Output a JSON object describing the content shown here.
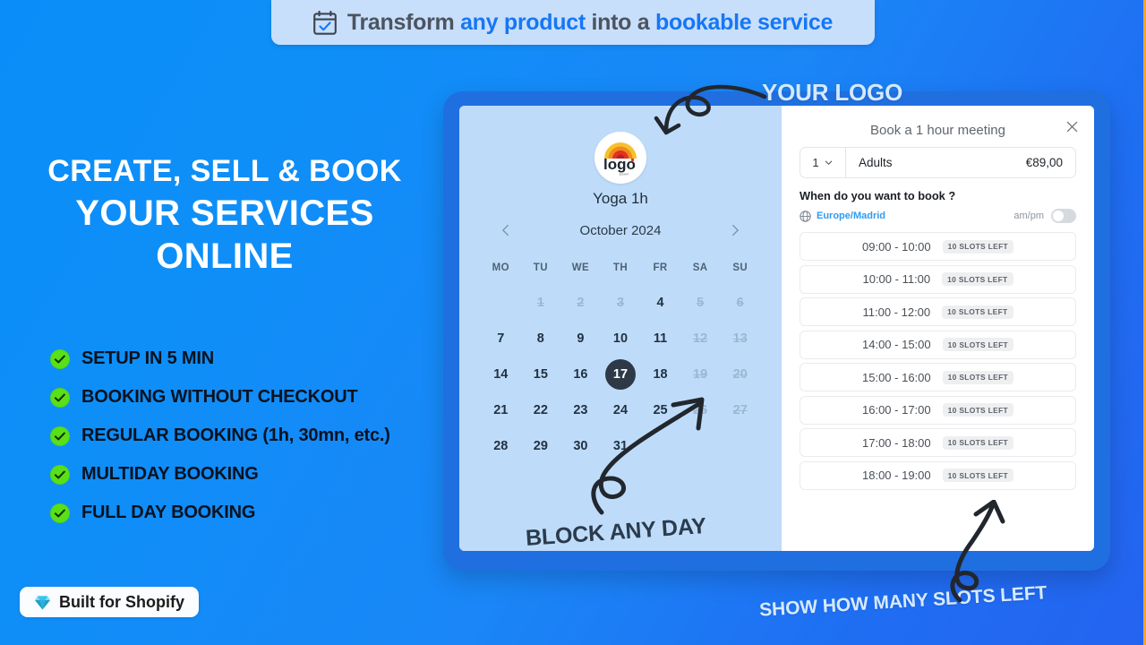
{
  "banner": {
    "icon": "calendar-check-icon",
    "segments": [
      {
        "text": "Transform ",
        "accent": false
      },
      {
        "text": "any product",
        "accent": true
      },
      {
        "text": " into a ",
        "accent": false
      },
      {
        "text": "bookable service",
        "accent": true
      }
    ],
    "full_text": "Transform any product into a bookable service"
  },
  "headline": {
    "line1": "CREATE, SELL & BOOK",
    "line2": "YOUR SERVICES",
    "line3": "ONLINE"
  },
  "features": [
    {
      "label": "SETUP IN 5 MIN",
      "icon": "check-circle-icon"
    },
    {
      "label": "BOOKING WITHOUT CHECKOUT",
      "icon": "check-circle-icon"
    },
    {
      "label": "REGULAR BOOKING (1h, 30mn, etc.)",
      "icon": "check-circle-icon"
    },
    {
      "label": "MULTIDAY BOOKING",
      "icon": "check-circle-icon"
    },
    {
      "label": "FULL DAY BOOKING",
      "icon": "check-circle-icon"
    }
  ],
  "badge": {
    "label": "Built for Shopify",
    "icon": "diamond-icon"
  },
  "calendar": {
    "logo_alt": "logo",
    "service_title": "Yoga 1h",
    "month_label": "October 2024",
    "prev_icon": "chevron-left-icon",
    "next_icon": "chevron-right-icon",
    "weekdays": [
      "MO",
      "TU",
      "WE",
      "TH",
      "FR",
      "SA",
      "SU"
    ],
    "leading_blanks": 1,
    "days": [
      {
        "n": "1",
        "state": "disabled"
      },
      {
        "n": "2",
        "state": "disabled"
      },
      {
        "n": "3",
        "state": "disabled"
      },
      {
        "n": "4",
        "state": "available"
      },
      {
        "n": "5",
        "state": "disabled"
      },
      {
        "n": "6",
        "state": "disabled"
      },
      {
        "n": "7",
        "state": "available"
      },
      {
        "n": "8",
        "state": "available"
      },
      {
        "n": "9",
        "state": "available"
      },
      {
        "n": "10",
        "state": "available"
      },
      {
        "n": "11",
        "state": "available"
      },
      {
        "n": "12",
        "state": "disabled"
      },
      {
        "n": "13",
        "state": "disabled"
      },
      {
        "n": "14",
        "state": "available"
      },
      {
        "n": "15",
        "state": "available"
      },
      {
        "n": "16",
        "state": "available"
      },
      {
        "n": "17",
        "state": "selected"
      },
      {
        "n": "18",
        "state": "available"
      },
      {
        "n": "19",
        "state": "disabled"
      },
      {
        "n": "20",
        "state": "disabled"
      },
      {
        "n": "21",
        "state": "available"
      },
      {
        "n": "22",
        "state": "available"
      },
      {
        "n": "23",
        "state": "available"
      },
      {
        "n": "24",
        "state": "available"
      },
      {
        "n": "25",
        "state": "available"
      },
      {
        "n": "26",
        "state": "disabled"
      },
      {
        "n": "27",
        "state": "disabled"
      },
      {
        "n": "28",
        "state": "available"
      },
      {
        "n": "29",
        "state": "available"
      },
      {
        "n": "30",
        "state": "available"
      },
      {
        "n": "31",
        "state": "available"
      }
    ]
  },
  "booking": {
    "title": "Book a 1 hour meeting",
    "close_icon": "close-icon",
    "quantity": "1",
    "quantity_chevron": "chevron-down-icon",
    "variant_label": "Adults",
    "price": "€89,00",
    "when_question": "When do you want to book ?",
    "timezone_icon": "globe-icon",
    "timezone": "Europe/Madrid",
    "ampm_label": "am/pm",
    "ampm_on": false,
    "slots": [
      {
        "time": "09:00 - 10:00",
        "badge": "10 SLOTS LEFT"
      },
      {
        "time": "10:00 - 11:00",
        "badge": "10 SLOTS LEFT"
      },
      {
        "time": "11:00 - 12:00",
        "badge": "10 SLOTS LEFT"
      },
      {
        "time": "14:00 - 15:00",
        "badge": "10 SLOTS LEFT"
      },
      {
        "time": "15:00 - 16:00",
        "badge": "10 SLOTS LEFT"
      },
      {
        "time": "16:00 - 17:00",
        "badge": "10 SLOTS LEFT"
      },
      {
        "time": "17:00 - 18:00",
        "badge": "10 SLOTS LEFT"
      },
      {
        "time": "18:00 - 19:00",
        "badge": "10 SLOTS LEFT"
      }
    ]
  },
  "annotations": {
    "your_logo": "YOUR LOGO",
    "block_any_day": "BLOCK ANY DAY",
    "show_slots": "SHOW HOW MANY SLOTS LEFT"
  },
  "colors": {
    "background_start": "#0a8df8",
    "background_end": "#2463ef",
    "accent_blue": "#1677f5",
    "frame_blue": "#1f6fe0",
    "calendar_pane": "#bedcfa",
    "check_green": "#59e016",
    "selected_day": "#2e3947",
    "timezone_link": "#2f9bf2",
    "edge_line": "#f4a22b"
  }
}
